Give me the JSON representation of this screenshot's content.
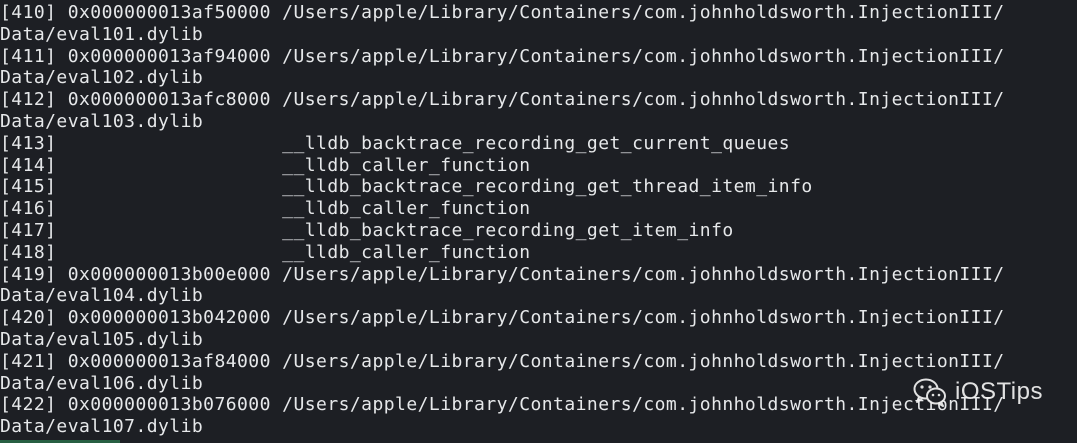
{
  "terminal": {
    "lines": [
      "[410] 0x000000013af50000 /Users/apple/Library/Containers/com.johnholdsworth.InjectionIII/",
      "Data/eval101.dylib",
      "[411] 0x000000013af94000 /Users/apple/Library/Containers/com.johnholdsworth.InjectionIII/",
      "Data/eval102.dylib",
      "[412] 0x000000013afc8000 /Users/apple/Library/Containers/com.johnholdsworth.InjectionIII/",
      "Data/eval103.dylib",
      "[413]                    __lldb_backtrace_recording_get_current_queues",
      "[414]                    __lldb_caller_function",
      "[415]                    __lldb_backtrace_recording_get_thread_item_info",
      "[416]                    __lldb_caller_function",
      "[417]                    __lldb_backtrace_recording_get_item_info",
      "[418]                    __lldb_caller_function",
      "[419] 0x000000013b00e000 /Users/apple/Library/Containers/com.johnholdsworth.InjectionIII/",
      "Data/eval104.dylib",
      "[420] 0x000000013b042000 /Users/apple/Library/Containers/com.johnholdsworth.InjectionIII/",
      "Data/eval105.dylib",
      "[421] 0x000000013af84000 /Users/apple/Library/Containers/com.johnholdsworth.InjectionIII/",
      "Data/eval106.dylib",
      "[422] 0x000000013b076000 /Users/apple/Library/Containers/com.johnholdsworth.InjectionIII/",
      "Data/eval107.dylib"
    ]
  },
  "watermark": {
    "text": "iOSTips",
    "icon": "wechat-icon"
  }
}
